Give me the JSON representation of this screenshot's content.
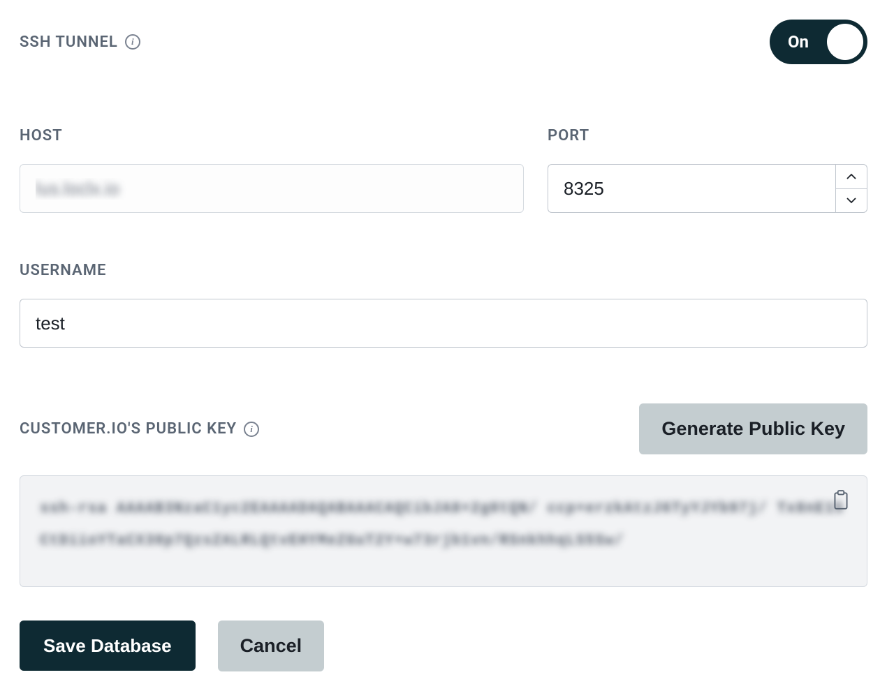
{
  "ssh_tunnel": {
    "label": "SSH TUNNEL",
    "toggle_state": "On"
  },
  "host": {
    "label": "HOST",
    "value": "lus.loclx.io"
  },
  "port": {
    "label": "PORT",
    "value": "8325"
  },
  "username": {
    "label": "USERNAME",
    "value": "test"
  },
  "public_key": {
    "label": "CUSTOMER.IO'S PUBLIC KEY",
    "generate_button": "Generate Public Key",
    "content": "ssh-rsa AAAAB3NzaC1yc2EAAAADAQABAAACAQCibJA8+2g0tQN/ ccp+erzkAtzJ6TyYJYb97j/ Tx8nE15CtDiioYTaCX30p7QzsZALRLQtvEHYMeZGuT2Y+w73rjb1vn/RSnkhhqLS5Sw/"
  },
  "actions": {
    "save": "Save Database",
    "cancel": "Cancel"
  }
}
